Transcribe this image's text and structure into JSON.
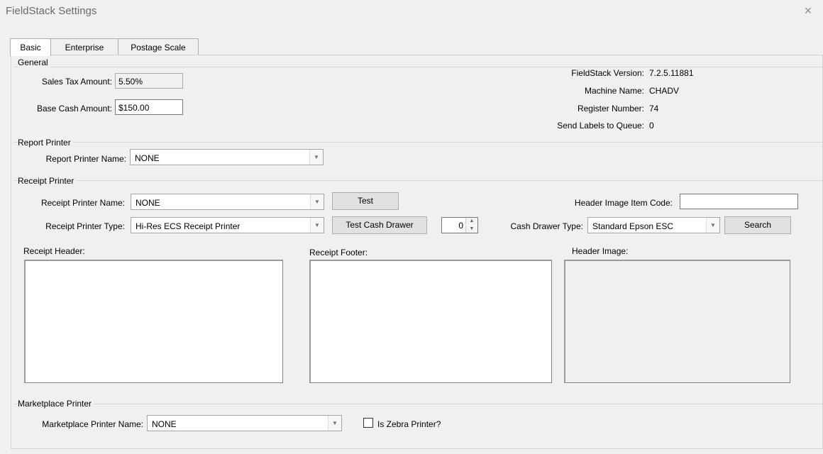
{
  "window": {
    "title": "FieldStack Settings",
    "close_glyph": "×"
  },
  "tabs": [
    {
      "label": "Basic"
    },
    {
      "label": "Enterprise"
    },
    {
      "label": "Postage Scale"
    }
  ],
  "general": {
    "title": "General",
    "sales_tax_label": "Sales Tax Amount:",
    "sales_tax_value": "5.50%",
    "base_cash_label": "Base Cash Amount:",
    "base_cash_value": "$150.00",
    "version_label": "FieldStack Version:",
    "version_value": "7.2.5.11881",
    "machine_label": "Machine Name:",
    "machine_value": "CHADV",
    "register_label": "Register Number:",
    "register_value": "74",
    "queue_label": "Send Labels to Queue:",
    "queue_value": "0"
  },
  "report_printer": {
    "title": "Report Printer",
    "name_label": "Report Printer Name:",
    "name_value": "NONE"
  },
  "receipt_printer": {
    "title": "Receipt Printer",
    "name_label": "Receipt Printer Name:",
    "name_value": "NONE",
    "test_button": "Test",
    "type_label": "Receipt Printer Type:",
    "type_value": "Hi-Res ECS Receipt Printer",
    "test_drawer_button": "Test Cash Drawer",
    "drawer_number": "0",
    "header_image_code_label": "Header Image Item Code:",
    "header_image_code_value": "",
    "cash_drawer_type_label": "Cash Drawer Type:",
    "cash_drawer_type_value": "Standard Epson ESC",
    "search_button": "Search",
    "header_label": "Receipt Header:",
    "footer_label": "Receipt Footer:",
    "header_image_label": "Header Image:"
  },
  "marketplace_printer": {
    "title": "Marketplace Printer",
    "name_label": "Marketplace Printer Name:",
    "name_value": "NONE",
    "zebra_label": "Is Zebra Printer?",
    "zebra_checked": false
  },
  "icons": {
    "dropdown": "chevron-down-icon",
    "close": "close-icon"
  }
}
